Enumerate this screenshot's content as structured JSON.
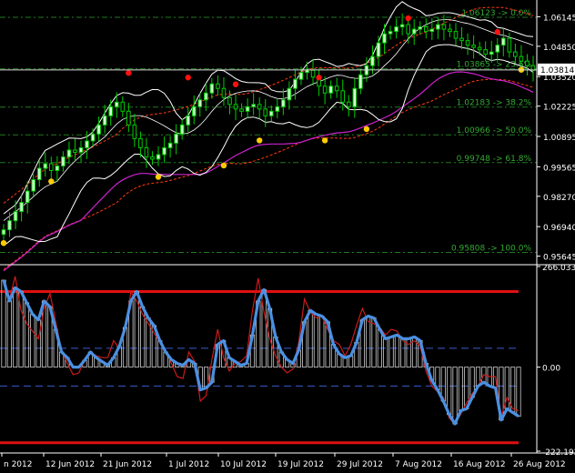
{
  "chart_data": [
    {
      "type": "candlestick",
      "panel": "price",
      "title": "",
      "ylim": [
        0.9535,
        1.068
      ],
      "y_ticks": [
        "1.06145",
        "1.04850",
        "1.03520",
        "1.02225",
        "1.00895",
        "0.99565",
        "0.98270",
        "0.96940",
        "0.95645"
      ],
      "last_price_label": "1.03814",
      "colors": {
        "background": "#000000",
        "bull_body": "#ccffcc",
        "bear_body": "#000000",
        "candle_outline": "#00cc00",
        "grid": "#1f6b1f",
        "bollinger": "#ffffff",
        "envelope": "#ff3b10",
        "slow_ma": "#cc22cc",
        "fractal_up": "#ff1111",
        "fractal_down": "#ffcc00",
        "fib_line": "#1f7a1f",
        "fib_text": "#33aa33",
        "axis_text": "#ffffff"
      },
      "fibonacci_levels": [
        {
          "value": 1.06123,
          "label": "1.06123 -> 0.0%"
        },
        {
          "value": 1.03865,
          "label": "1.03865 -> 23.6%"
        },
        {
          "value": 1.02183,
          "label": "1.02183 -> 38.2%"
        },
        {
          "value": 1.00966,
          "label": "1.00966 -> 50.0%"
        },
        {
          "value": 0.99748,
          "label": "0.99748 -> 61.8%"
        },
        {
          "value": 0.95808,
          "label": "0.95808 -> 100.0%"
        }
      ],
      "close_path": [
        0.968,
        0.972,
        0.976,
        0.98,
        0.985,
        0.99,
        0.995,
        0.997,
        0.994,
        0.996,
        1.0,
        1.003,
        1.002,
        1.004,
        1.007,
        1.01,
        1.014,
        1.018,
        1.022,
        1.024,
        1.02,
        1.014,
        1.008,
        1.004,
        1.0,
        0.999,
        1.001,
        1.004,
        1.006,
        1.01,
        1.014,
        1.018,
        1.022,
        1.025,
        1.028,
        1.032,
        1.03,
        1.026,
        1.023,
        1.021,
        1.02,
        1.022,
        1.023,
        1.021,
        1.018,
        1.02,
        1.022,
        1.025,
        1.03,
        1.034,
        1.037,
        1.038,
        1.035,
        1.031,
        1.028,
        1.031,
        1.029,
        1.024,
        1.022,
        1.03,
        1.036,
        1.04,
        1.044,
        1.05,
        1.054,
        1.055,
        1.057,
        1.058,
        1.054,
        1.056,
        1.057,
        1.055,
        1.056,
        1.058,
        1.056,
        1.055,
        1.052,
        1.051,
        1.049,
        1.048,
        1.047,
        1.045,
        1.046,
        1.049,
        1.052,
        1.046,
        1.044,
        1.042,
        1.04,
        1.038
      ],
      "fractals_up": [
        [
          21,
          1.036
        ],
        [
          31,
          1.034
        ],
        [
          39,
          1.031
        ],
        [
          53,
          1.034
        ],
        [
          68,
          1.06
        ],
        [
          83,
          1.054
        ]
      ],
      "fractals_down": [
        [
          0,
          0.963
        ],
        [
          8,
          0.99
        ],
        [
          26,
          0.992
        ],
        [
          37,
          0.997
        ],
        [
          43,
          1.008
        ],
        [
          54,
          1.008
        ],
        [
          61,
          1.013
        ],
        [
          87,
          1.039
        ]
      ]
    },
    {
      "type": "line",
      "panel": "oscillator",
      "ylim": [
        -222.192,
        266.0337
      ],
      "y_ticks": [
        "266.0337",
        "0.00",
        "-222.192"
      ],
      "levels": {
        "overbought": 200,
        "oversold": -200,
        "upper_dashed": 50,
        "lower_dashed": -50
      },
      "series": [
        {
          "role": "main",
          "color": "#4a90e2",
          "values": [
            230,
            175,
            210,
            200,
            170,
            140,
            125,
            175,
            160,
            100,
            40,
            25,
            0,
            0,
            18,
            40,
            25,
            15,
            5,
            25,
            55,
            105,
            175,
            200,
            160,
            130,
            110,
            70,
            40,
            20,
            10,
            5,
            20,
            10,
            -60,
            -55,
            -40,
            60,
            70,
            25,
            15,
            5,
            10,
            85,
            175,
            205,
            155,
            80,
            40,
            20,
            10,
            45,
            120,
            150,
            140,
            135,
            120,
            60,
            35,
            25,
            30,
            65,
            125,
            135,
            130,
            100,
            75,
            80,
            85,
            75,
            75,
            80,
            70,
            10,
            -35,
            -60,
            -90,
            -125,
            -150,
            -115,
            -110,
            -80,
            -50,
            -40,
            -50,
            -55,
            -140,
            -110,
            -120,
            -130
          ]
        },
        {
          "role": "signal",
          "color": "#cc1a1a",
          "values": [
            220,
            180,
            240,
            150,
            115,
            95,
            75,
            155,
            195,
            120,
            45,
            10,
            -20,
            -15,
            20,
            40,
            30,
            25,
            25,
            70,
            50,
            95,
            200,
            175,
            140,
            115,
            90,
            65,
            45,
            10,
            -25,
            -30,
            40,
            15,
            -90,
            -75,
            20,
            100,
            25,
            -10,
            10,
            15,
            30,
            150,
            235,
            145,
            75,
            30,
            0,
            -15,
            -5,
            65,
            180,
            145,
            130,
            135,
            100,
            70,
            60,
            30,
            60,
            110,
            155,
            120,
            115,
            105,
            85,
            100,
            95,
            70,
            60,
            70,
            55,
            -10,
            -50,
            -65,
            -80,
            -135,
            -150,
            -125,
            -95,
            -70,
            -50,
            -20,
            -25,
            -25,
            -130,
            -80,
            -110,
            -115
          ]
        }
      ]
    }
  ],
  "x_axis": {
    "labels": [
      "n 2012",
      "12 Jun 2012",
      "21 Jun 2012",
      "1 Jul 2012",
      "10 Jul 2012",
      "19 Jul 2012",
      "29 Jul 2012",
      "7 Aug 2012",
      "16 Aug 2012",
      "26 Aug 2012"
    ]
  }
}
